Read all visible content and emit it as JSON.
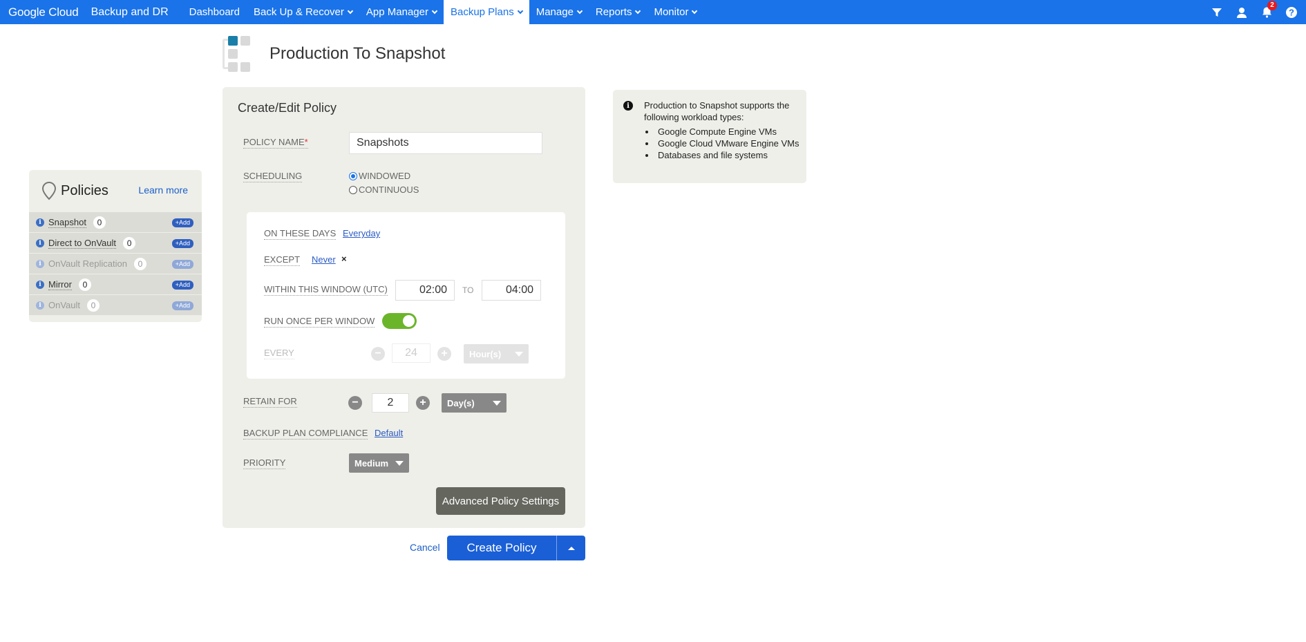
{
  "header": {
    "brand_google": "Google Cloud",
    "brand_product": "Backup and DR",
    "nav": [
      {
        "label": "Dashboard"
      },
      {
        "label": "Back Up & Recover"
      },
      {
        "label": "App Manager"
      },
      {
        "label": "Backup Plans"
      },
      {
        "label": "Manage"
      },
      {
        "label": "Reports"
      },
      {
        "label": "Monitor"
      }
    ],
    "active_nav": "Backup Plans",
    "notification_count": "2",
    "icons": [
      "filter-icon",
      "user-icon",
      "bell-icon",
      "help-icon"
    ]
  },
  "page": {
    "title": "Production To Snapshot"
  },
  "policies_panel": {
    "title": "Policies",
    "learn_more": "Learn more",
    "items": [
      {
        "label": "Snapshot",
        "count": "0",
        "add": "+Add",
        "enabled": true
      },
      {
        "label": "Direct to OnVault",
        "count": "0",
        "add": "+Add",
        "enabled": true
      },
      {
        "label": "OnVault Replication",
        "count": "0",
        "add": "+Add",
        "enabled": false
      },
      {
        "label": "Mirror",
        "count": "0",
        "add": "+Add",
        "enabled": true
      },
      {
        "label": "OnVault",
        "count": "0",
        "add": "+Add",
        "enabled": false
      }
    ]
  },
  "form": {
    "title": "Create/Edit Policy",
    "policy_name_label": "POLICY NAME",
    "required_mark": "*",
    "policy_name_value": "Snapshots",
    "scheduling_label": "SCHEDULING",
    "scheduling_options": [
      "WINDOWED",
      "CONTINUOUS"
    ],
    "scheduling_selected": "WINDOWED",
    "on_these_days_label": "ON THESE DAYS",
    "on_these_days_value": "Everyday",
    "except_label": "EXCEPT",
    "except_value": "Never",
    "except_clear": "×",
    "window_label": "WITHIN THIS WINDOW (UTC)",
    "window_start": "02:00",
    "window_to": "TO",
    "window_end": "04:00",
    "run_once_label": "RUN ONCE PER WINDOW",
    "run_once_on": true,
    "every_label": "EVERY",
    "every_value": "24",
    "every_unit": "Hour(s)",
    "retain_label": "RETAIN FOR",
    "retain_value": "2",
    "retain_unit": "Day(s)",
    "compliance_label": "BACKUP PLAN COMPLIANCE",
    "compliance_value": "Default",
    "priority_label": "PRIORITY",
    "priority_value": "Medium",
    "advanced_button": "Advanced Policy Settings",
    "minus": "−",
    "plus": "+"
  },
  "actions": {
    "cancel": "Cancel",
    "create": "Create Policy"
  },
  "info": {
    "icon": "info-icon",
    "text": "Production to Snapshot supports the following workload types:",
    "items": [
      "Google Compute Engine VMs",
      "Google Cloud VMware Engine VMs",
      "Databases and file systems"
    ]
  },
  "colors": {
    "topbar": "#1a73e8",
    "panel": "#efefea",
    "toggle_on": "#6bb52a",
    "primary_button": "#1a5fd6"
  }
}
